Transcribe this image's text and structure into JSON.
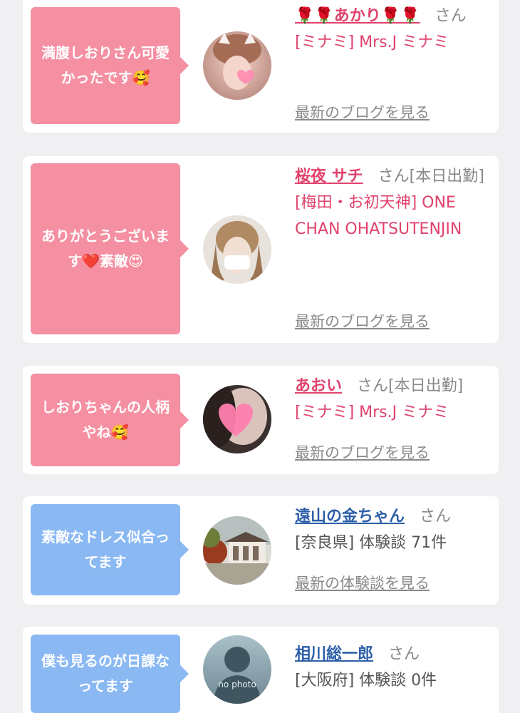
{
  "comments": [
    {
      "theme": "pink",
      "message": "満腹しおりさん可愛かったです🥰",
      "name": "🌹🌹あかり🌹🌹",
      "honorific": "さん",
      "shop": "[ミナミ] Mrs.J ミナミ",
      "link": "最新のブログを見る"
    },
    {
      "theme": "pink",
      "message": "ありがとうございます❤️素敵😍",
      "name": "桜夜 サチ",
      "honorific": "さん[本日出勤]",
      "shop": "[梅田・お初天神] ONE CHAN OHATSUTENJIN",
      "link": "最新のブログを見る"
    },
    {
      "theme": "pink",
      "message": "しおりちゃんの人柄やね🥰",
      "name": "あおい",
      "honorific": "さん[本日出勤]",
      "shop": "[ミナミ] Mrs.J ミナミ",
      "link": "最新のブログを見る"
    },
    {
      "theme": "blue",
      "message": "素敵なドレス似合ってます",
      "name": "遠山の金ちゃん",
      "honorific": "さん",
      "shop": "[奈良県] 体験談 71件",
      "link": "最新の体験談を見る"
    },
    {
      "theme": "blue",
      "message": "僕も見るのが日課なってます",
      "name": "相川総一郎",
      "honorific": "さん",
      "shop": "[大阪府] 体験談 0件",
      "avatar_text": "no photo"
    }
  ],
  "colors": {
    "pink_bubble": "#f58fa2",
    "blue_bubble": "#8ab8f3",
    "pink_name": "#e0426c",
    "blue_name": "#2d5fa8",
    "background": "#f0f0f2"
  }
}
